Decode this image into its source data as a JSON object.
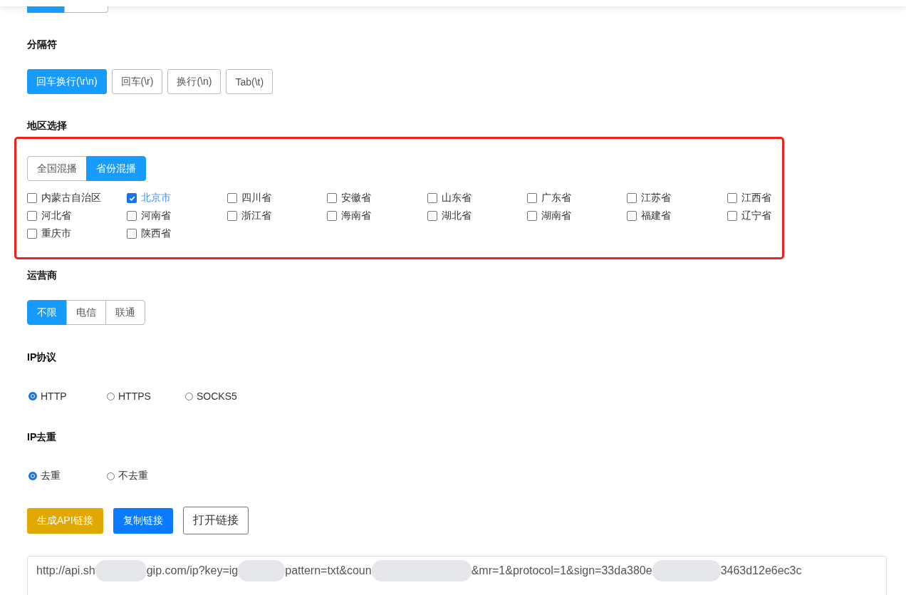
{
  "top_toggle": [
    {
      "selected": true
    },
    {
      "selected": false
    }
  ],
  "separator": {
    "title": "分隔符",
    "options": [
      {
        "label": "回车换行(\\r\\n)",
        "selected": true
      },
      {
        "label": "回车(\\r)",
        "selected": false
      },
      {
        "label": "换行(\\n)",
        "selected": false
      },
      {
        "label": "Tab(\\t)",
        "selected": false
      }
    ]
  },
  "region": {
    "title": "地区选择",
    "modes": [
      {
        "label": "全国混播",
        "selected": false
      },
      {
        "label": "省份混播",
        "selected": true
      }
    ],
    "provinces": [
      {
        "label": "内蒙古自治区",
        "checked": false
      },
      {
        "label": "北京市",
        "checked": true
      },
      {
        "label": "四川省",
        "checked": false
      },
      {
        "label": "安徽省",
        "checked": false
      },
      {
        "label": "山东省",
        "checked": false
      },
      {
        "label": "广东省",
        "checked": false
      },
      {
        "label": "江苏省",
        "checked": false
      },
      {
        "label": "江西省",
        "checked": false
      },
      {
        "label": "河北省",
        "checked": false
      },
      {
        "label": "河南省",
        "checked": false
      },
      {
        "label": "浙江省",
        "checked": false
      },
      {
        "label": "海南省",
        "checked": false
      },
      {
        "label": "湖北省",
        "checked": false
      },
      {
        "label": "湖南省",
        "checked": false
      },
      {
        "label": "福建省",
        "checked": false
      },
      {
        "label": "辽宁省",
        "checked": false
      },
      {
        "label": "重庆市",
        "checked": false
      },
      {
        "label": "陕西省",
        "checked": false
      }
    ]
  },
  "carrier": {
    "title": "运营商",
    "options": [
      {
        "label": "不限",
        "selected": true
      },
      {
        "label": "电信",
        "selected": false
      },
      {
        "label": "联通",
        "selected": false
      }
    ]
  },
  "protocol": {
    "title": "IP协议",
    "options": [
      {
        "label": "HTTP",
        "selected": true
      },
      {
        "label": "HTTPS",
        "selected": false
      },
      {
        "label": "SOCKS5",
        "selected": false
      }
    ]
  },
  "dedupe": {
    "title": "IP去重",
    "options": [
      {
        "label": "去重",
        "selected": true
      },
      {
        "label": "不去重",
        "selected": false
      }
    ]
  },
  "actions": [
    {
      "label": "生成API链接",
      "kind": "warning"
    },
    {
      "label": "复制链接",
      "kind": "primary"
    },
    {
      "label": "打开链接",
      "kind": "outline"
    }
  ],
  "url_segments": [
    "http://api.sh",
    "gip.com/ip?key=ig",
    "pattern=txt&coun",
    "&mr=1&protocol=1&sign=33da380e",
    "3463d12e6ec3c"
  ]
}
